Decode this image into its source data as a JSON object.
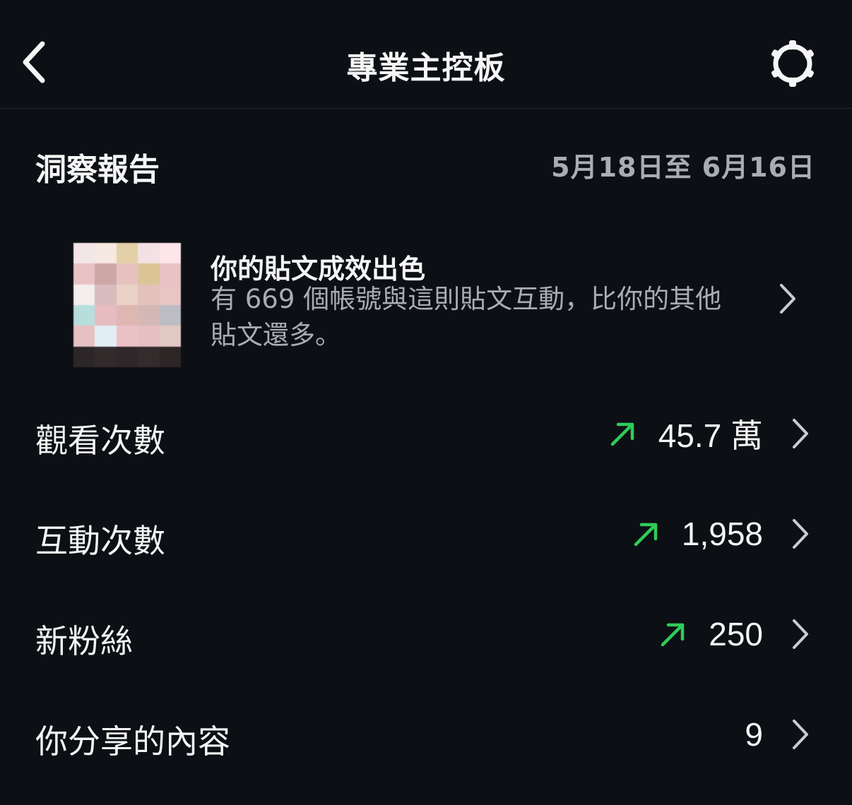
{
  "header": {
    "title": "專業主控板",
    "back_icon": "chevron-left-icon",
    "settings_icon": "gear-icon"
  },
  "insights": {
    "title": "洞察報告",
    "date_range": "5月18日至 6月16日"
  },
  "highlight": {
    "title": "你的貼文成效出色",
    "description": "有 669 個帳號與這則貼文互動，比你的其他貼文還多。",
    "thumbnail_colors": [
      "#f3e6e9",
      "#f5e9e2",
      "#e4d0a8",
      "#f2e2e5",
      "#fde6e8",
      "#e9c3c4",
      "#cfa6a6",
      "#e6c2c0",
      "#dbc596",
      "#e8c2c4",
      "#f4eeee",
      "#d9bcbd",
      "#ead3c6",
      "#e4c1bd",
      "#e8c5c3",
      "#b6dedd",
      "#e7bcc0",
      "#deb7b2",
      "#d4b8b5",
      "#bdbcc4",
      "#e6c1c2",
      "#e1eef6",
      "#eac1c6",
      "#e7bfc2",
      "#e2c8c2",
      "#2c2628",
      "#332a2c",
      "#2f2729",
      "#332b2c",
      "#2e2526"
    ]
  },
  "metrics": [
    {
      "label": "觀看次數",
      "value": "45.7 萬",
      "trend": "up"
    },
    {
      "label": "互動次數",
      "value": "1,958",
      "trend": "up"
    },
    {
      "label": "新粉絲",
      "value": "250",
      "trend": "up"
    },
    {
      "label": "你分享的內容",
      "value": "9",
      "trend": "none"
    }
  ],
  "colors": {
    "background": "#0c1014",
    "trend_up": "#2fcc59",
    "secondary_text": "#a8adb3"
  }
}
